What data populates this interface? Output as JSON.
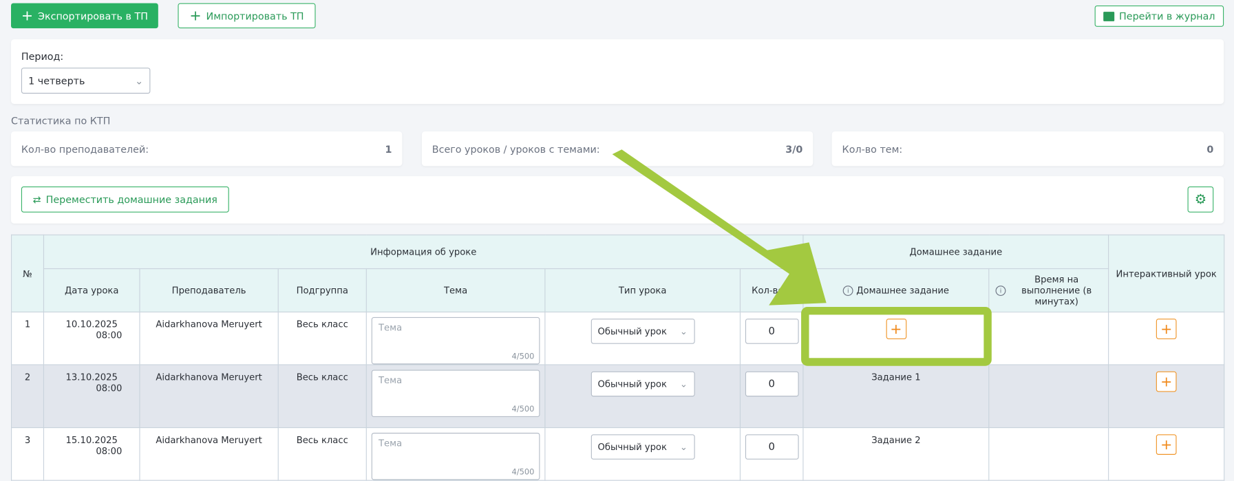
{
  "toolbar": {
    "export_label": "Экспортировать в ТП",
    "import_label": "Импортировать ТП",
    "journal_label": "Перейти в журнал"
  },
  "period": {
    "label": "Период:",
    "value": "1 четверть"
  },
  "stats": {
    "title": "Статистика по КТП",
    "items": [
      {
        "label": "Кол-во преподавателей:",
        "value": "1"
      },
      {
        "label": "Всего уроков / уроков с темами:",
        "value": "3/0"
      },
      {
        "label": "Кол-во тем:",
        "value": "0"
      }
    ]
  },
  "actions": {
    "move_homework_label": "Переместить домашние задания"
  },
  "table": {
    "group_headers": {
      "num": "№",
      "lesson_info": "Информация об уроке",
      "homework": "Домашнее задание",
      "interactive": "Интерактивный урок"
    },
    "columns": {
      "date": "Дата урока",
      "teacher": "Преподаватель",
      "subgroup": "Подгруппа",
      "topic": "Тема",
      "type": "Тип урока",
      "count": "Кол-во т",
      "homework": "Домашнее задание",
      "time": "Время на выполнение (в минутах)"
    },
    "rows": [
      {
        "num": "1",
        "date": "10.10.2025",
        "time": "08:00",
        "teacher": "Aidarkhanova Meruyert",
        "subgroup": "Весь класс",
        "topic_placeholder": "Тема",
        "topic_count": "4/500",
        "type": "Обычный урок",
        "count": "0",
        "homework": ""
      },
      {
        "num": "2",
        "date": "13.10.2025",
        "time": "08:00",
        "teacher": "Aidarkhanova Meruyert",
        "subgroup": "Весь класс",
        "topic_placeholder": "Тема",
        "topic_count": "4/500",
        "type": "Обычный урок",
        "count": "0",
        "homework": "Задание 1"
      },
      {
        "num": "3",
        "date": "15.10.2025",
        "time": "08:00",
        "teacher": "Aidarkhanova Meruyert",
        "subgroup": "Весь класс",
        "topic_placeholder": "Тема",
        "topic_count": "4/500",
        "type": "Обычный урок",
        "count": "0",
        "homework": "Задание 2"
      }
    ]
  },
  "annotation": {
    "color": "#a3c940"
  }
}
